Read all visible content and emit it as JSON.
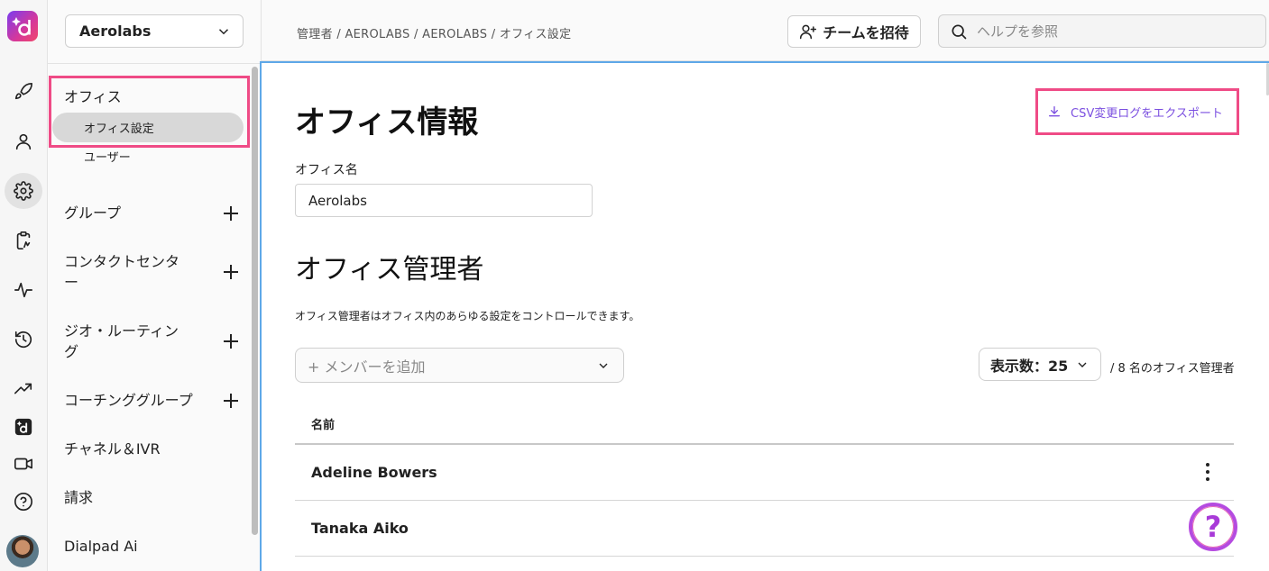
{
  "sidebar": {
    "org_name": "Aerolabs",
    "items": [
      {
        "label": "オフィス",
        "sub": [
          "オフィス設定",
          "ユーザー"
        ]
      },
      {
        "label": "グループ"
      },
      {
        "label": "コンタクトセンター"
      },
      {
        "label": "ジオ・ルーティング"
      },
      {
        "label": "コーチンググループ"
      },
      {
        "label": "チャネル＆IVR"
      },
      {
        "label": "請求"
      },
      {
        "label": "Dialpad Ai"
      }
    ]
  },
  "rail": {
    "icons": [
      "dialpad-logo-icon",
      "rocket-icon",
      "person-icon",
      "gear-icon",
      "clipboard-chart-icon",
      "activity-icon",
      "history-icon",
      "trending-up-icon",
      "dialpad-square-icon",
      "video-icon",
      "help-circle-icon",
      "avatar"
    ]
  },
  "topbar": {
    "breadcrumb": "管理者 / AEROLABS / AEROLABS / オフィス設定",
    "invite_label": "チームを招待",
    "search_placeholder": "ヘルプを参照"
  },
  "main": {
    "title": "オフィス情報",
    "export_label": "CSV変更ログをエクスポート",
    "office_name_label": "オフィス名",
    "office_name_value": "Aerolabs",
    "admins_title": "オフィス管理者",
    "admins_desc": "オフィス管理者はオフィス内のあらゆる設定をコントロールできます。",
    "add_member_placeholder": "+ メンバーを追加",
    "per_page_label": "表示数：25",
    "count_label": "/ 8 名のオフィス管理者",
    "table_header_name": "名前",
    "rows": [
      "Adeline Bowers",
      "Tanaka Aiko"
    ],
    "help_fab": "?"
  },
  "colors": {
    "highlight": "#ef4b86",
    "accent": "#7b4fe0",
    "focus_border": "#5ea8e8"
  }
}
